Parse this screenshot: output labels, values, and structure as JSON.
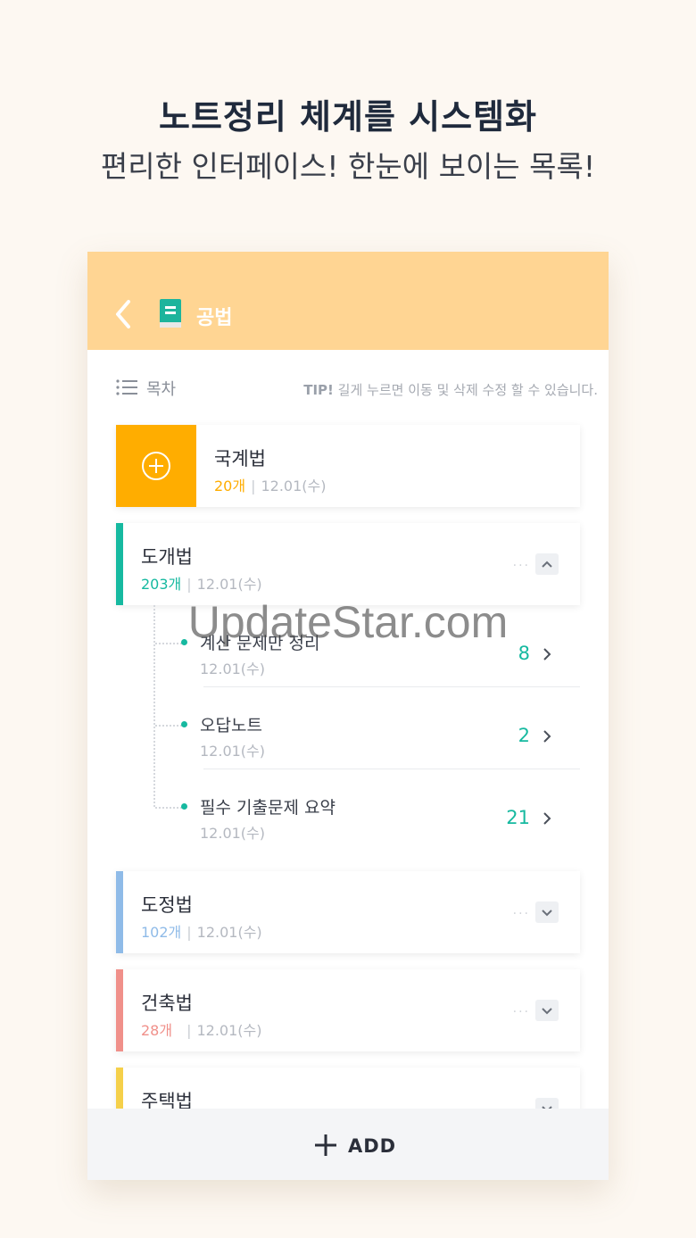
{
  "promo": {
    "headline": "노트정리 체계를 시스템화",
    "subline": "편리한 인터페이스! 한눈에 보이는 목록!"
  },
  "appbar": {
    "title": "공법",
    "background": "#ffd593"
  },
  "toc": {
    "label": "목차",
    "tip_strong": "TIP!",
    "tip_text": "길게 누르면 이동 및 삭제 수정 할 수 있습니다."
  },
  "categories": [
    {
      "title": "국계법",
      "count": "20개",
      "date": "12.01(수)",
      "color": "#ffad00",
      "state": "add"
    },
    {
      "title": "도개법",
      "count": "203개",
      "date": "12.01(수)",
      "color": "#16b9a0",
      "state": "expanded"
    },
    {
      "title": "도정법",
      "count": "102개",
      "date": "12.01(수)",
      "color": "#8fbbe8",
      "state": "collapsed"
    },
    {
      "title": "건축법",
      "count": "28개",
      "date": "12.01(수)",
      "color": "#f0908a",
      "state": "collapsed"
    },
    {
      "title": "주택법",
      "count": "",
      "date": "",
      "color": "#f5d04a",
      "state": "collapsed"
    }
  ],
  "sub_items": [
    {
      "title": "계산 문제만 정리",
      "date": "12.01(수)",
      "count": "8"
    },
    {
      "title": "오답노트",
      "date": "12.01(수)",
      "count": "2"
    },
    {
      "title": "필수 기출문제 요약",
      "date": "12.01(수)",
      "count": "21"
    }
  ],
  "bottom": {
    "add_label": "ADD"
  },
  "watermark": "UpdateStar.com"
}
